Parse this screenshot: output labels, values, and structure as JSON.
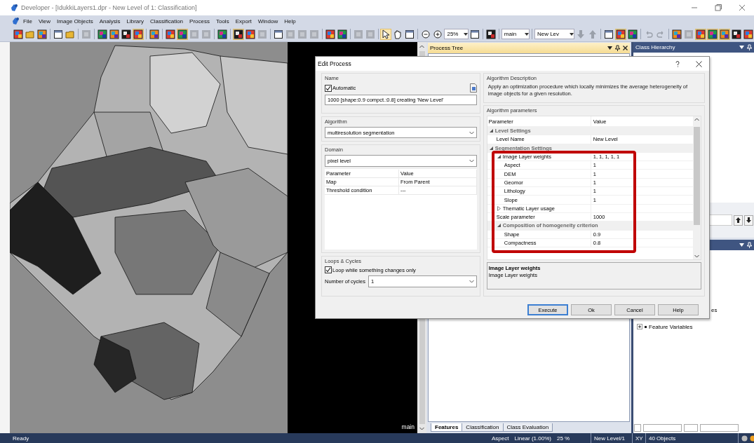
{
  "window": {
    "title": "Developer - [IdukkiLayers1.dpr - New Level of 1: Classification]"
  },
  "menu": [
    "File",
    "View",
    "Image Objects",
    "Analysis",
    "Library",
    "Classification",
    "Process",
    "Tools",
    "Export",
    "Window",
    "Help"
  ],
  "toolbar": [
    {
      "kind": "color",
      "on": false
    },
    {
      "kind": "folder",
      "on": false
    },
    {
      "kind": "color",
      "on": false
    },
    {
      "kind": "sep"
    },
    {
      "kind": "doc",
      "on": false
    },
    {
      "kind": "folder",
      "on": false
    },
    {
      "kind": "sep"
    },
    {
      "kind": "grey",
      "on": false
    },
    {
      "kind": "sep"
    },
    {
      "kind": "color",
      "on": false
    },
    {
      "kind": "color",
      "on": false
    },
    {
      "kind": "color",
      "on": false
    },
    {
      "kind": "color",
      "on": true
    },
    {
      "kind": "sep"
    },
    {
      "kind": "color",
      "on": false
    },
    {
      "kind": "sep"
    },
    {
      "kind": "color",
      "on": false
    },
    {
      "kind": "color",
      "on": true
    },
    {
      "kind": "grey",
      "on": false
    },
    {
      "kind": "grey",
      "on": false
    },
    {
      "kind": "sep"
    },
    {
      "kind": "color",
      "on": false
    },
    {
      "kind": "sep"
    },
    {
      "kind": "color",
      "on": true
    },
    {
      "kind": "color",
      "on": false
    },
    {
      "kind": "grey",
      "on": false
    },
    {
      "kind": "sep"
    },
    {
      "kind": "doc",
      "on": false
    },
    {
      "kind": "grey",
      "on": false
    },
    {
      "kind": "grey",
      "on": false
    },
    {
      "kind": "grey",
      "on": false
    },
    {
      "kind": "sep"
    },
    {
      "kind": "color",
      "on": false
    },
    {
      "kind": "color",
      "on": false
    },
    {
      "kind": "sep"
    },
    {
      "kind": "grey",
      "on": false
    },
    {
      "kind": "grey",
      "on": false
    },
    {
      "kind": "sep"
    },
    {
      "kind": "pointer",
      "on": true
    },
    {
      "kind": "hand",
      "on": false
    },
    {
      "kind": "doc",
      "on": false
    },
    {
      "kind": "sep"
    },
    {
      "kind": "zoomout",
      "on": false
    },
    {
      "kind": "zoomin",
      "on": false
    },
    {
      "kind": "combo",
      "value": "25%"
    },
    {
      "kind": "doc",
      "on": false
    },
    {
      "kind": "sep"
    },
    {
      "kind": "color",
      "on": false
    },
    {
      "kind": "sep"
    },
    {
      "kind": "combo",
      "value": "main"
    },
    {
      "kind": "sep"
    },
    {
      "kind": "combo",
      "value": "New Lev"
    },
    {
      "kind": "down",
      "on": false
    },
    {
      "kind": "up",
      "on": false
    },
    {
      "kind": "sep"
    },
    {
      "kind": "doc",
      "on": false
    },
    {
      "kind": "color",
      "on": true
    },
    {
      "kind": "color",
      "on": false
    },
    {
      "kind": "sep"
    },
    {
      "kind": "undo",
      "on": false
    },
    {
      "kind": "redo",
      "on": false
    },
    {
      "kind": "sep"
    },
    {
      "kind": "color",
      "on": false
    },
    {
      "kind": "grey",
      "on": false
    },
    {
      "kind": "color",
      "on": true
    },
    {
      "kind": "color",
      "on": true
    },
    {
      "kind": "color",
      "on": true
    },
    {
      "kind": "color",
      "on": false
    },
    {
      "kind": "color",
      "on": false
    }
  ],
  "image_view": {
    "label": "main"
  },
  "process_tree": {
    "title": "Process Tree",
    "tabs": [
      {
        "label": "Features",
        "selected": true
      },
      {
        "label": "Classification",
        "selected": false
      },
      {
        "label": "Class Evaluation",
        "selected": false
      }
    ]
  },
  "class_hierarchy": {
    "title": "Class Hierarchy"
  },
  "feature_view": {
    "cut_label": "es",
    "items": [
      {
        "label": "Feature Variables",
        "expanded": false
      }
    ]
  },
  "dialog": {
    "title": "Edit Process",
    "name_group": {
      "title": "Name",
      "automatic": {
        "label": "Automatic",
        "checked": true
      },
      "value": "1000 [shape:0.9 compct.:0.8] creating 'New Level'"
    },
    "algorithm_group": {
      "title": "Algorithm",
      "value": "multiresolution segmentation"
    },
    "domain_group": {
      "title": "Domain",
      "value": "pixel level",
      "columns": [
        "Parameter",
        "Value"
      ],
      "rows": [
        [
          "Map",
          "From Parent"
        ],
        [
          "Threshold condition",
          "---"
        ]
      ]
    },
    "loops_group": {
      "title": "Loops & Cycles",
      "loop": {
        "label": "Loop while something changes only",
        "checked": true
      },
      "cycles_label": "Number of cycles",
      "cycles": "1"
    },
    "description_group": {
      "title": "Algorithm Description",
      "text": "Apply an optimization procedure which locally minimizes the average heterogeneity of image objects for a given resolution."
    },
    "parameters_group": {
      "title": "Algorithm parameters",
      "columns": [
        "Parameter",
        "Value"
      ],
      "rows": [
        {
          "kind": "category",
          "label": "Level Settings",
          "expanded": true,
          "children": [
            {
              "kind": "property",
              "label": "Level Name",
              "value": "New Level"
            }
          ]
        },
        {
          "kind": "category",
          "label": "Segmentation Settings",
          "expanded": true,
          "children": [
            {
              "kind": "property",
              "label": "Image Layer weights",
              "value": "1, 1, 1, 1, 1",
              "expanded": true,
              "children": [
                {
                  "kind": "property",
                  "label": "Aspect",
                  "value": "1"
                },
                {
                  "kind": "property",
                  "label": "DEM",
                  "value": "1"
                },
                {
                  "kind": "property",
                  "label": "Geomor",
                  "value": "1"
                },
                {
                  "kind": "property",
                  "label": "Lithology",
                  "value": "1"
                },
                {
                  "kind": "property",
                  "label": "Slope",
                  "value": "1"
                }
              ]
            },
            {
              "kind": "property",
              "label": "Thematic Layer usage",
              "expanded": false
            },
            {
              "kind": "property",
              "label": "Scale parameter",
              "value": "1000"
            },
            {
              "kind": "category",
              "label": "Composition of homogeneity criterion",
              "expanded": true,
              "children": [
                {
                  "kind": "property",
                  "label": "Shape",
                  "value": "0.9"
                },
                {
                  "kind": "property",
                  "label": "Compactness",
                  "value": "0.8"
                }
              ]
            }
          ]
        }
      ],
      "help_title": "Image Layer weights",
      "help_text": "Image Layer weights"
    },
    "buttons": [
      {
        "label": "Execute",
        "default": true
      },
      {
        "label": "Ok",
        "default": false
      },
      {
        "label": "Cancel",
        "default": false
      },
      {
        "label": "Help",
        "default": false
      }
    ]
  },
  "status_bar": {
    "message": "Ready",
    "segments": [
      {
        "texts": [
          "Aspect",
          "Linear (1.00%)",
          "25 %"
        ]
      },
      {
        "texts": [
          "New Level/1"
        ]
      },
      {
        "texts": [
          "XY"
        ]
      },
      {
        "texts": [
          "40 Objects"
        ]
      }
    ]
  }
}
